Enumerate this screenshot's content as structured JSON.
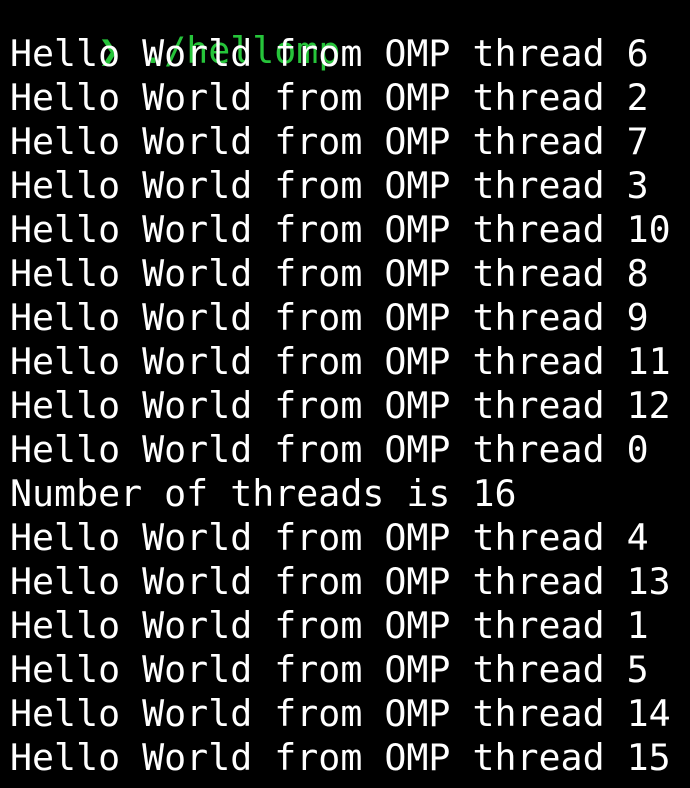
{
  "prompt": {
    "symbol": "❯",
    "command": " ./hellomp"
  },
  "output_lines": [
    "Hello World from OMP thread 6",
    "Hello World from OMP thread 2",
    "Hello World from OMP thread 7",
    "Hello World from OMP thread 3",
    "Hello World from OMP thread 10",
    "Hello World from OMP thread 8",
    "Hello World from OMP thread 9",
    "Hello World from OMP thread 11",
    "Hello World from OMP thread 12",
    "Hello World from OMP thread 0",
    "Number of threads is 16",
    "Hello World from OMP thread 4",
    "Hello World from OMP thread 13",
    "Hello World from OMP thread 1",
    "Hello World from OMP thread 5",
    "Hello World from OMP thread 14",
    "Hello World from OMP thread 15"
  ],
  "colors": {
    "background": "#000000",
    "text": "#ffffff",
    "prompt": "#26c43a"
  }
}
